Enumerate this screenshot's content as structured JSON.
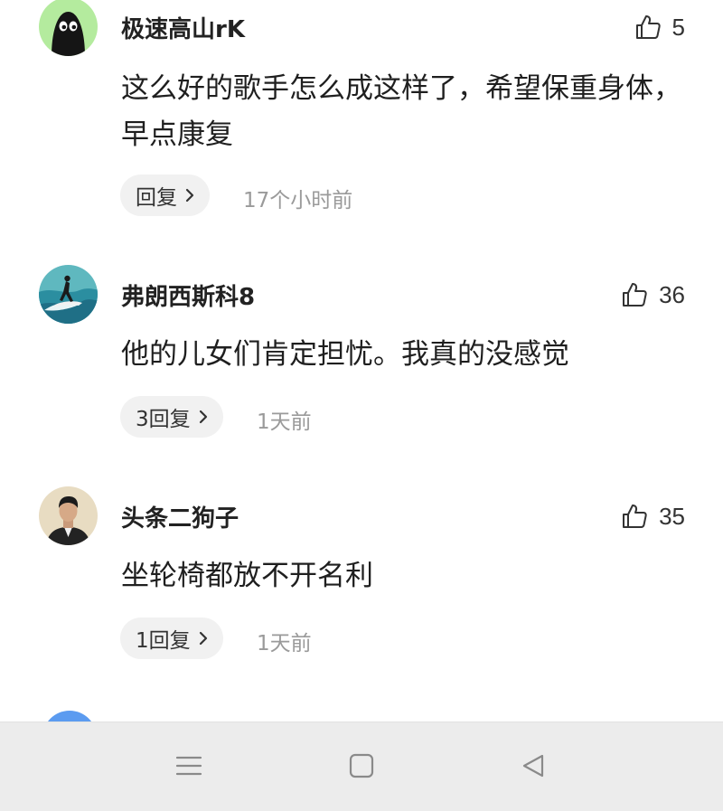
{
  "comments": [
    {
      "avatar_icon": "black-ghost-avatar-icon",
      "username": "极速高山rK",
      "like_count": "5",
      "text": "这么好的歌手怎么成这样了，希望保重身体，早点康复",
      "reply_label": "回复",
      "time": "17个小时前"
    },
    {
      "avatar_icon": "surfer-photo-avatar-icon",
      "username": "弗朗西斯科8",
      "like_count": "36",
      "text": "他的儿女们肯定担忧。我真的没感觉",
      "reply_label": "3回复",
      "time": "1天前"
    },
    {
      "avatar_icon": "man-portrait-avatar-icon",
      "username": "头条二狗子",
      "like_count": "35",
      "text": "坐轮椅都放不开名利",
      "reply_label": "1回复",
      "time": "1天前"
    }
  ],
  "icons": {
    "like": "thumbs-up-icon",
    "reply_arrow": "chevron-right-icon",
    "nav_menu": "menu-lines-icon",
    "nav_home": "square-home-icon",
    "nav_back": "triangle-back-icon"
  },
  "colors": {
    "background": "#ffffff",
    "text": "#1f1f1f",
    "muted": "#9a9a9a",
    "reply_pill": "#f1f1f1",
    "navbar": "#ececec",
    "avatar_green": "#b4eb9e",
    "partial_avatar": "#5b9bf0"
  }
}
